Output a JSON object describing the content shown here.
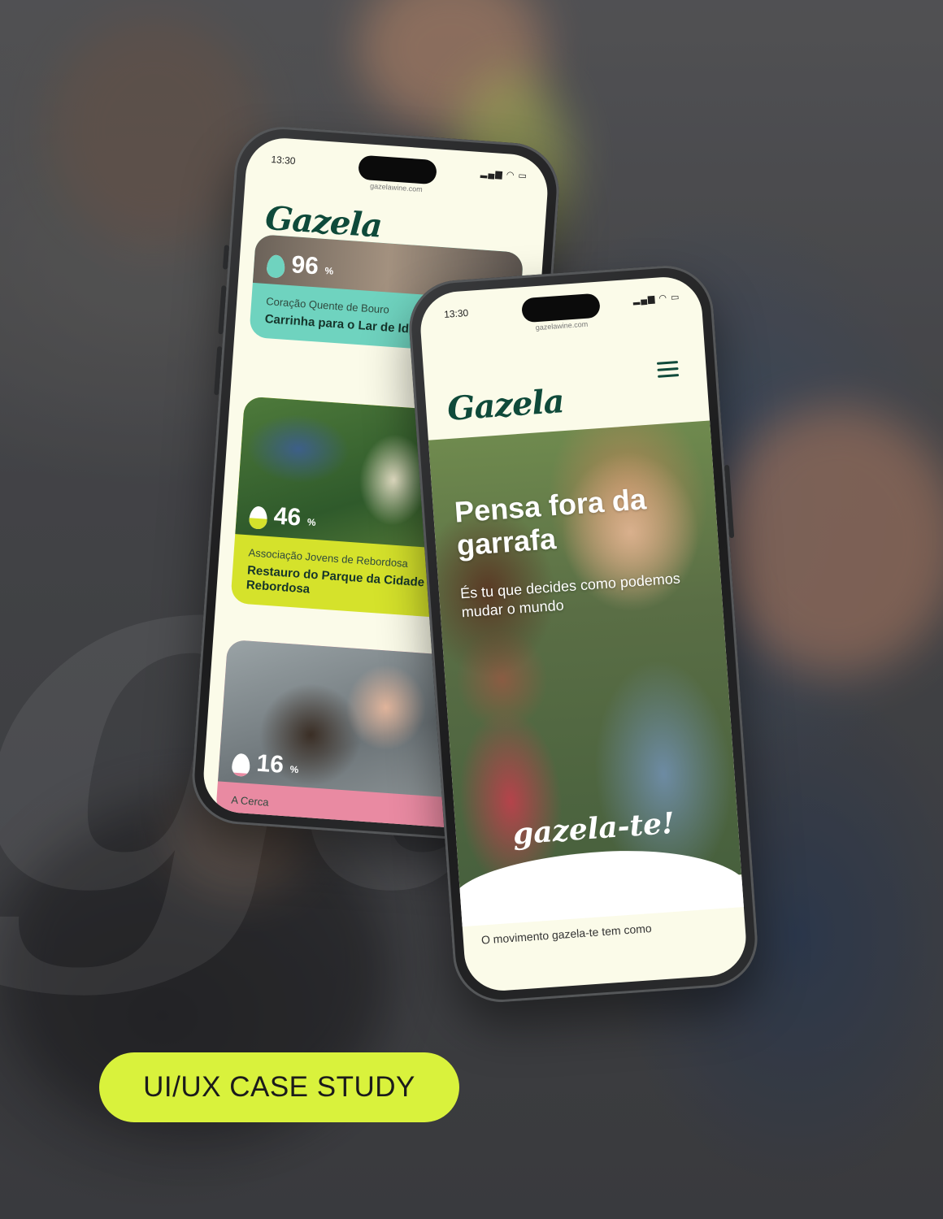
{
  "brand": {
    "logo": "Gazela",
    "accent": "#d9f23c",
    "logo_color": "#0f4a3a"
  },
  "phone_back": {
    "status_time": "13:30",
    "url": "gazelawine.com",
    "cards": [
      {
        "percent": "96",
        "unit": "%",
        "org": "Coração Quente de Bouro",
        "title": "Carrinha para o Lar de Idosos de Bouro",
        "color": "#6fd3bf",
        "fill": 1.0
      },
      {
        "percent": "46",
        "unit": "%",
        "org": "Associação Jovens de Rebordosa",
        "title": "Restauro do Parque da Cidade de Rebordosa",
        "color": "#d5e22b",
        "fill": 0.46
      },
      {
        "percent": "16",
        "unit": "%",
        "org": "A Cerca",
        "title": "",
        "color": "#e98aa2",
        "fill": 0.16
      }
    ]
  },
  "phone_front": {
    "status_time": "13:30",
    "url": "gazelawine.com",
    "hero_title": "Pensa fora da garrafa",
    "hero_subtitle": "És tu que decides como podemos mudar o mundo",
    "slogan": "gazela-te!",
    "intro_text": "O movimento gazela-te tem como"
  },
  "badge": {
    "label": "UI/UX CASE STUDY"
  }
}
